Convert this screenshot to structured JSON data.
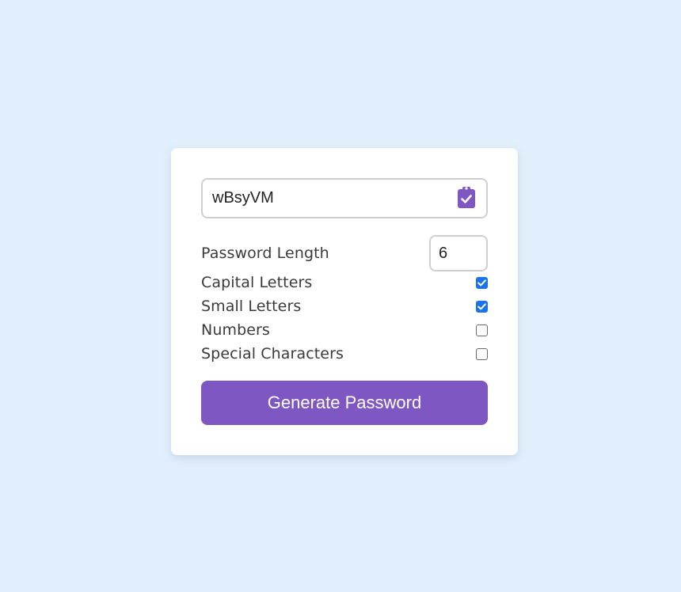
{
  "generator": {
    "password_value": "wBsyVM",
    "copy_icon": "clipboard-check-icon",
    "length_label": "Password Length",
    "length_value": "6",
    "options": [
      {
        "label": "Capital Letters",
        "checked": true
      },
      {
        "label": "Small Letters",
        "checked": true
      },
      {
        "label": "Numbers",
        "checked": false
      },
      {
        "label": "Special Characters",
        "checked": false
      }
    ],
    "generate_label": "Generate Password"
  },
  "colors": {
    "background": "#e1effc",
    "card": "#ffffff",
    "accent": "#7e57c2",
    "checkbox_checked": "#1a73e8"
  }
}
